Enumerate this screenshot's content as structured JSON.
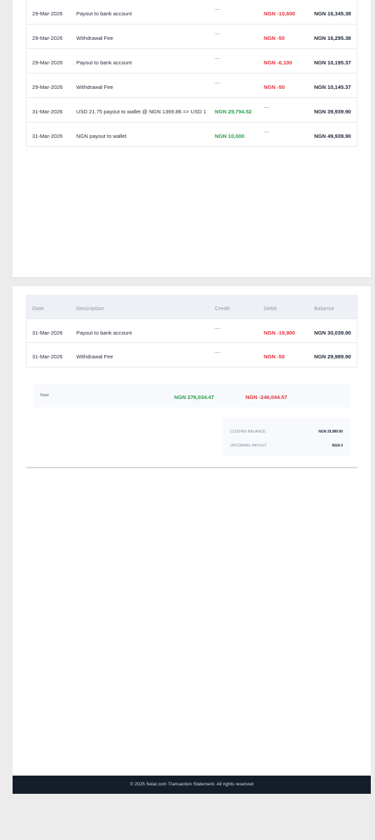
{
  "page1": {
    "rows": [
      {
        "date": "29-Mar-2026",
        "description": "Payout to bank account",
        "credit": "—",
        "debit": "NGN -10,600",
        "balance": "NGN 16,345.38"
      },
      {
        "date": "29-Mar-2026",
        "description": "Withdrawal Fee",
        "credit": "—",
        "debit": "NGN -50",
        "balance": "NGN 16,295.38"
      },
      {
        "date": "29-Mar-2026",
        "description": "Payout to bank account",
        "credit": "—",
        "debit": "NGN -6,100",
        "balance": "NGN 10,195.37"
      },
      {
        "date": "29-Mar-2026",
        "description": "Withdrawal Fee",
        "credit": "—",
        "debit": "NGN -50",
        "balance": "NGN 10,145.37"
      },
      {
        "date": "31-Mar-2026",
        "description": "USD 21.75 payout to wallet @ NGN 1369.86 => USD 1",
        "credit": "NGN 29,794.52",
        "debit": "—",
        "balance": "NGN 39,939.90"
      },
      {
        "date": "31-Mar-2026",
        "description": "NGN payout to wallet",
        "credit": "NGN 10,000",
        "debit": "—",
        "balance": "NGN 49,939.90"
      }
    ]
  },
  "page2": {
    "headers": {
      "date": "Date",
      "description": "Description",
      "credit": "Credit",
      "debit": "Debit",
      "balance": "Balance"
    },
    "rows": [
      {
        "date": "31-Mar-2026",
        "description": "Payout to bank account",
        "credit": "—",
        "debit": "NGN -19,900",
        "balance": "NGN 30,039.90"
      },
      {
        "date": "31-Mar-2026",
        "description": "Withdrawal Fee",
        "credit": "—",
        "debit": "NGN -50",
        "balance": "NGN 29,989.90"
      }
    ],
    "totals": {
      "label": "Total:",
      "credit": "NGN 276,034.47",
      "debit": "NGN -246,044.57"
    },
    "summary": {
      "closing_label": "CLOSING BALANCE:",
      "closing_value": "NGN 29,989.90",
      "upcoming_label": "UPCOMING PAYOUT:",
      "upcoming_value": "NGN 0"
    }
  },
  "footer": {
    "text": "© 2025 Selar.com Transaction Statement. All rights reserved"
  }
}
